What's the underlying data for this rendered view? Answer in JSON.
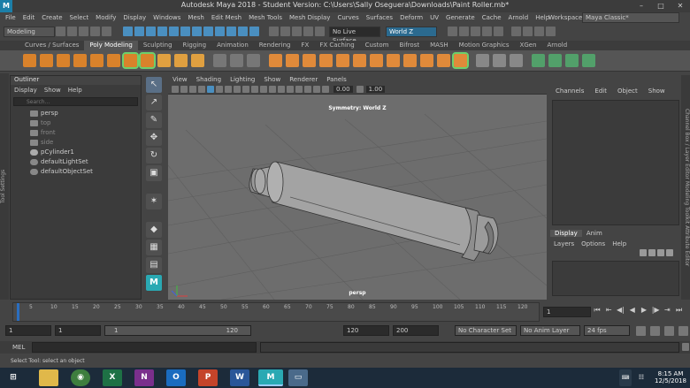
{
  "titlebar": {
    "title": "Autodesk Maya 2018 - Student Version: C:\\Users\\Sally Oseguera\\Downloads\\Paint Roller.mb*",
    "minimize": "–",
    "maximize": "□",
    "close": "✕"
  },
  "menubar": {
    "items": [
      "File",
      "Edit",
      "Create",
      "Select",
      "Modify",
      "Display",
      "Windows",
      "Mesh",
      "Edit Mesh",
      "Mesh Tools",
      "Mesh Display",
      "Curves",
      "Surfaces",
      "Deform",
      "UV",
      "Generate",
      "Cache",
      "Arnold",
      "Help"
    ],
    "workspace_label": "Workspace :",
    "workspace_value": "Maya Classic*"
  },
  "statusline": {
    "mode": "Modeling",
    "live_surface": "No Live Surface",
    "symmetry": "World Z"
  },
  "shelftabs": [
    "Curves / Surfaces",
    "Poly Modeling",
    "Sculpting",
    "Rigging",
    "Animation",
    "Rendering",
    "FX",
    "FX Caching",
    "Custom",
    "Bifrost",
    "MASH",
    "Motion Graphics",
    "XGen",
    "Arnold"
  ],
  "left_strip": "Tool Settings",
  "outliner": {
    "title": "Outliner",
    "menus": [
      "Display",
      "Show",
      "Help"
    ],
    "search_placeholder": "Search...",
    "items": [
      {
        "label": "persp",
        "dim": false
      },
      {
        "label": "top",
        "dim": true
      },
      {
        "label": "front",
        "dim": true
      },
      {
        "label": "side",
        "dim": true
      },
      {
        "label": "pCylinder1",
        "dim": false
      },
      {
        "label": "defaultLightSet",
        "dim": false
      },
      {
        "label": "defaultObjectSet",
        "dim": false
      }
    ]
  },
  "viewport": {
    "menus": [
      "View",
      "Shading",
      "Lighting",
      "Show",
      "Renderer",
      "Panels"
    ],
    "val1": "0.00",
    "val2": "1.00",
    "symmetry_label": "Symmetry: World Z",
    "camera_label": "persp"
  },
  "channelbox": {
    "menus": [
      "Channels",
      "Edit",
      "Object",
      "Show"
    ],
    "layer_tabs": [
      "Display",
      "Anim"
    ],
    "layer_menus": [
      "Layers",
      "Options",
      "Help"
    ]
  },
  "right_strip": "Channel Box / Layer Editor     Modeling Toolkit     Attribute Editor",
  "timeline": {
    "ticks": [
      "5",
      "10",
      "15",
      "20",
      "25",
      "30",
      "35",
      "40",
      "45",
      "50",
      "55",
      "60",
      "65",
      "70",
      "75",
      "80",
      "85",
      "90",
      "95",
      "100",
      "105",
      "110",
      "115",
      "120"
    ],
    "current_frame": "1"
  },
  "rangebar": {
    "start": "1",
    "start2": "1",
    "range_start": "1",
    "range_end": "120",
    "end": "120",
    "end2": "200",
    "character_set": "No Character Set",
    "anim_layer": "No Anim Layer",
    "fps": "24 fps"
  },
  "cmdline": {
    "label": "MEL"
  },
  "helpline": {
    "text": "Select Tool: select an object"
  },
  "taskbar": {
    "time": "8:15 AM",
    "date": "12/5/2018"
  }
}
